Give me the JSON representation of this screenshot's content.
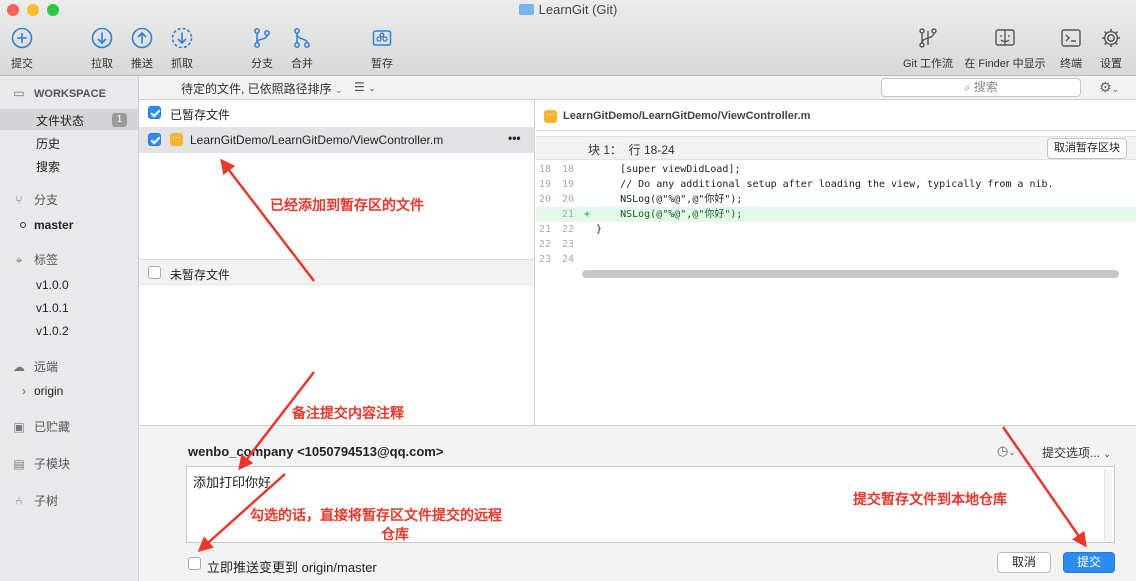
{
  "window": {
    "title": "LearnGit (Git)"
  },
  "toolbar": {
    "items": [
      {
        "label": "提交",
        "icon": "plus-circle-icon"
      },
      {
        "label": "拉取",
        "icon": "pull-icon"
      },
      {
        "label": "推送",
        "icon": "push-icon"
      },
      {
        "label": "抓取",
        "icon": "fetch-icon"
      },
      {
        "label": "分支",
        "icon": "branch-icon"
      },
      {
        "label": "合并",
        "icon": "merge-icon"
      },
      {
        "label": "暂存",
        "icon": "stash-icon"
      },
      {
        "label": "Git 工作流",
        "icon": "git-flow-icon"
      },
      {
        "label": "在 Finder 中显示",
        "icon": "finder-icon"
      },
      {
        "label": "终端",
        "icon": "terminal-icon"
      },
      {
        "label": "设置",
        "icon": "gear-icon"
      }
    ]
  },
  "filterbar": {
    "sort_label": "待定的文件, 已依照路径排序",
    "view_toggle": "☰",
    "search_placeholder": "搜索"
  },
  "sidebar": {
    "workspace_title": "WORKSPACE",
    "workspace_items": [
      "文件状态",
      "历史",
      "搜索"
    ],
    "file_status_badge": "1",
    "branches_title": "分支",
    "current_branch": "master",
    "tags_title": "标签",
    "tags": [
      "v1.0.0",
      "v1.0.1",
      "v1.0.2"
    ],
    "remotes_title": "远端",
    "remotes": [
      "origin"
    ],
    "stashes_title": "已贮藏",
    "submodules_title": "子模块",
    "subtrees_title": "子树"
  },
  "staged": {
    "header": "已暂存文件",
    "files": [
      {
        "path": "LearnGitDemo/LearnGitDemo/ViewController.m",
        "more": "•••"
      }
    ]
  },
  "unstaged": {
    "header": "未暂存文件"
  },
  "diff": {
    "file": "LearnGitDemo/LearnGitDemo/ViewController.m",
    "hunk_label": "块 1：  行 18-24",
    "unstage_button": "取消暂存区块",
    "lines": [
      {
        "old": "18",
        "new": "18",
        "marker": "",
        "text": "    [super viewDidLoad];",
        "type": "ctx"
      },
      {
        "old": "19",
        "new": "19",
        "marker": "",
        "text": "    // Do any additional setup after loading the view, typically from a nib.",
        "type": "ctx"
      },
      {
        "old": "20",
        "new": "20",
        "marker": "",
        "text": "    NSLog(@\"%@\",@\"你好\");",
        "type": "ctx"
      },
      {
        "old": "",
        "new": "21",
        "marker": "+",
        "text": "    NSLog(@\"%@\",@\"你好\");",
        "type": "add"
      },
      {
        "old": "21",
        "new": "22",
        "marker": "",
        "text": "}",
        "type": "ctx"
      },
      {
        "old": "22",
        "new": "23",
        "marker": "",
        "text": "",
        "type": "ctx"
      },
      {
        "old": "23",
        "new": "24",
        "marker": "",
        "text": "",
        "type": "ctx"
      }
    ]
  },
  "commit": {
    "author": "wenbo_company <1050794513@qq.com>",
    "options_label": "提交选项...",
    "message": "添加打印你好",
    "push_checkbox_label": "立即推送变更到 origin/master",
    "cancel_label": "取消",
    "commit_label": "提交"
  },
  "annotations": {
    "staged_note": "已经添加到暂存区的文件",
    "message_note": "备注提交内容注释",
    "push_note_line1": "勾选的话，直接将暂存区文件提交的远程",
    "push_note_line2": "仓库",
    "commit_note": "提交暂存文件到本地仓库"
  },
  "colors": {
    "accent": "#2d8cf0",
    "annotation": "#e8372b",
    "added_line_bg": "#e4f8ea",
    "modified_badge": "#f5b431"
  }
}
